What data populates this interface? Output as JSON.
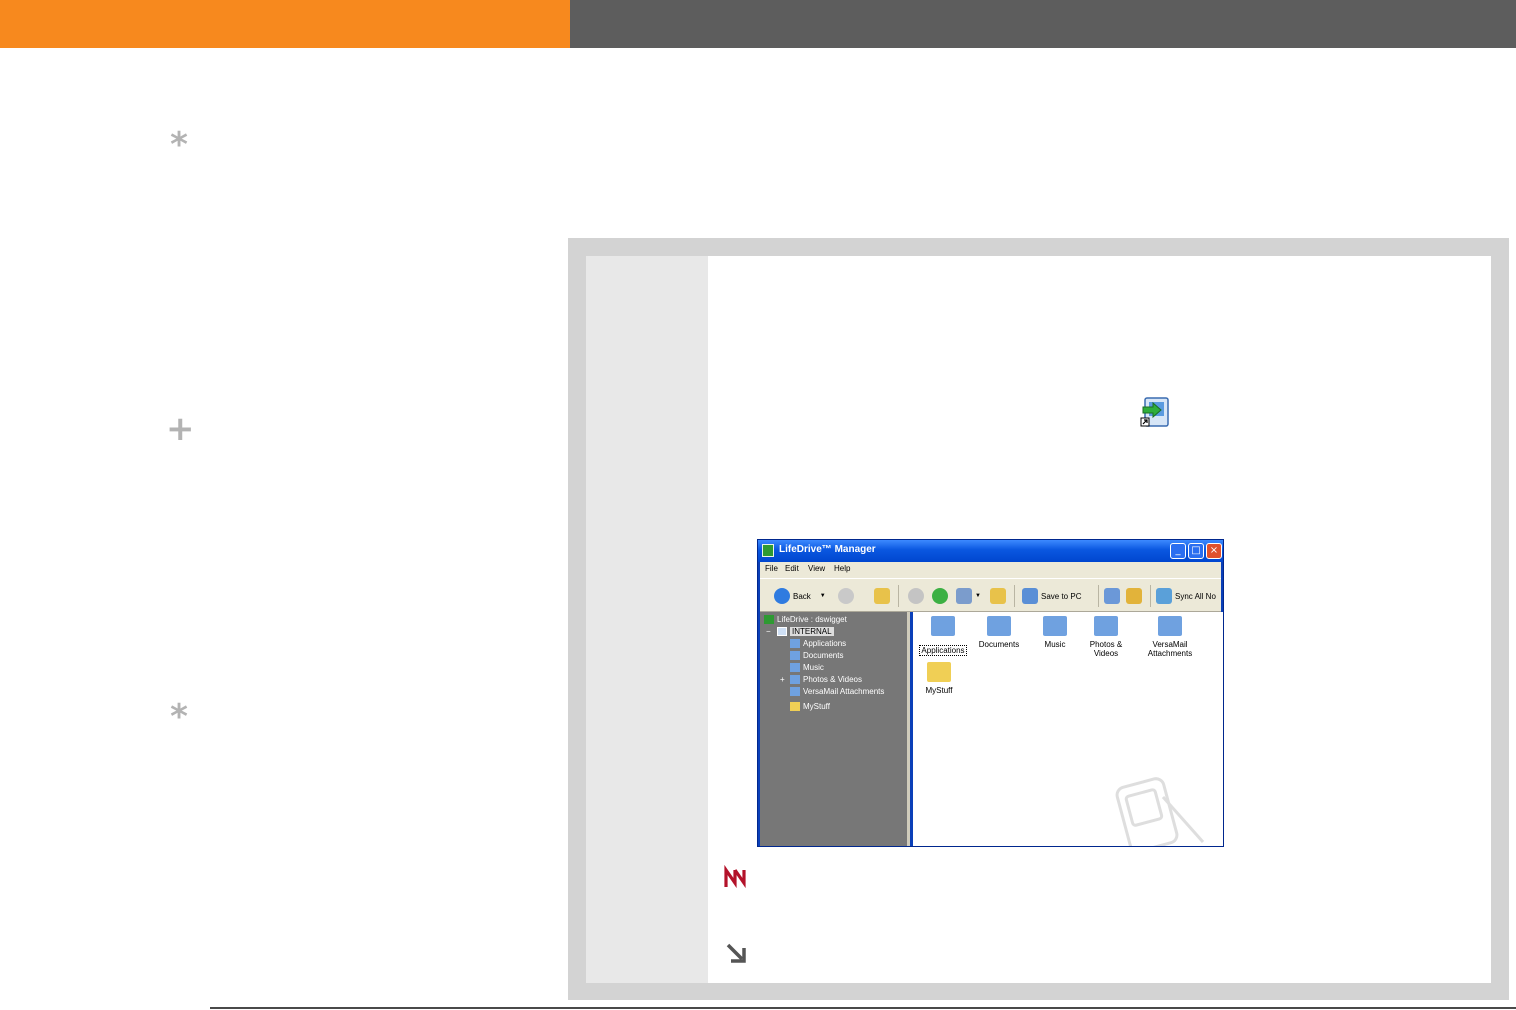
{
  "colors": {
    "header_left": "#f7891e",
    "header_right": "#5d5d5d",
    "side_glyph": "#b3b3b3",
    "note_icon": "#b3122a",
    "arrow_icon": "#555555"
  },
  "sidebar": {
    "glyphs": [
      {
        "name": "tip-asterisk-icon",
        "char": "*"
      },
      {
        "name": "plus-icon",
        "char": "+"
      },
      {
        "name": "tip-asterisk-icon",
        "char": "*"
      }
    ]
  },
  "app_screenshot": {
    "title": "LifeDrive™ Manager",
    "window_buttons": {
      "minimize": "_",
      "maximize": "□",
      "close": "×"
    },
    "menu": [
      "File",
      "Edit",
      "View",
      "Help"
    ],
    "toolbar": {
      "back_label": "Back",
      "save_to_pc_label": "Save to PC",
      "sync_all_label": "Sync All No"
    },
    "tree": {
      "root": "LifeDrive : dswigget",
      "selected": "INTERNAL",
      "expand_minus": "−",
      "expand_plus": "+",
      "items": [
        "Applications",
        "Documents",
        "Music",
        "Photos & Videos",
        "VersaMail Attachments",
        "MyStuff"
      ]
    },
    "folders": [
      {
        "label": "Applications",
        "icon": "applications-folder-icon"
      },
      {
        "label": "Documents",
        "icon": "documents-folder-icon"
      },
      {
        "label": "Music",
        "icon": "music-folder-icon"
      },
      {
        "label": "Photos & Videos",
        "icon": "photos-videos-folder-icon"
      },
      {
        "label": "VersaMail Attachments",
        "icon": "versamail-folder-icon"
      },
      {
        "label": "MyStuff",
        "icon": "mystuff-folder-icon"
      }
    ]
  }
}
